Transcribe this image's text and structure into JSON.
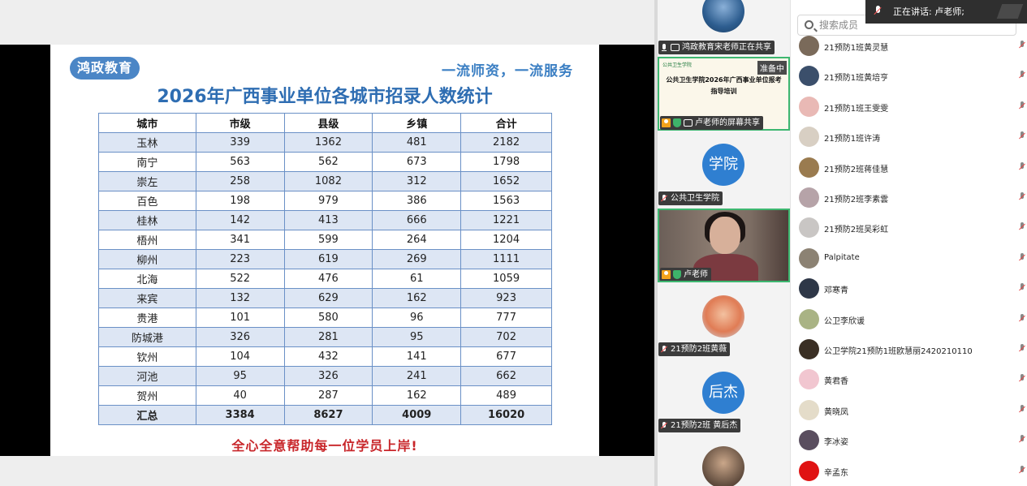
{
  "slide": {
    "logo": "鸿政教育",
    "slogan": "一流师资，一流服务",
    "title": "2026年广西事业单位各城市招录人数统计",
    "headers": [
      "城市",
      "市级",
      "县级",
      "乡镇",
      "合计"
    ],
    "rows": [
      [
        "玉林",
        "339",
        "1362",
        "481",
        "2182"
      ],
      [
        "南宁",
        "563",
        "562",
        "673",
        "1798"
      ],
      [
        "崇左",
        "258",
        "1082",
        "312",
        "1652"
      ],
      [
        "百色",
        "198",
        "979",
        "386",
        "1563"
      ],
      [
        "桂林",
        "142",
        "413",
        "666",
        "1221"
      ],
      [
        "梧州",
        "341",
        "599",
        "264",
        "1204"
      ],
      [
        "柳州",
        "223",
        "619",
        "269",
        "1111"
      ],
      [
        "北海",
        "522",
        "476",
        "61",
        "1059"
      ],
      [
        "来宾",
        "132",
        "629",
        "162",
        "923"
      ],
      [
        "贵港",
        "101",
        "580",
        "96",
        "777"
      ],
      [
        "防城港",
        "326",
        "281",
        "95",
        "702"
      ],
      [
        "钦州",
        "104",
        "432",
        "141",
        "677"
      ],
      [
        "河池",
        "95",
        "326",
        "241",
        "662"
      ],
      [
        "贺州",
        "40",
        "287",
        "162",
        "489"
      ]
    ],
    "total": [
      "汇总",
      "3384",
      "8627",
      "4009",
      "16020"
    ],
    "footer": "全心全意帮助每一位学员上岸!"
  },
  "video": {
    "sharing_label": "鸿政教育宋老师正在共享",
    "screen_badge": "准备中",
    "screen_logo": "公共卫生学院",
    "screen_title": "公共卫生学院2026年广西事业单位报考指导培训",
    "screen_share_label": "卢老师的屏幕共享",
    "college_avatar_text": "学院",
    "college_label": "公共卫生学院",
    "camera_label": "卢老师",
    "huangwei_label": "21预防2班黄薇",
    "houjie_avatar_text": "后杰",
    "houjie_label": "21预防2班  黄后杰",
    "colors": {
      "accent_green": "#3db770",
      "avatar_blue": "#2f7fd1"
    }
  },
  "members": {
    "search_placeholder": "搜索成员",
    "speaking": "正在讲话:  卢老师;",
    "items": [
      {
        "name": "21预防1班黄灵慧",
        "color": "#7a6a5a"
      },
      {
        "name": "21预防1班黄培亨",
        "color": "#3b4f6b"
      },
      {
        "name": "21预防1班王雯雯",
        "color": "#e9b9b5"
      },
      {
        "name": "21预防1班许涛",
        "color": "#d8cfc3"
      },
      {
        "name": "21预防2班蒋佳慧",
        "color": "#9a7b4f"
      },
      {
        "name": "21预防2班李素雲",
        "color": "#b6a3a8"
      },
      {
        "name": "21预防2班吴彩虹",
        "color": "#c9c6c4"
      },
      {
        "name": "Palpitate",
        "color": "#8c8273"
      },
      {
        "name": "邓寒青",
        "color": "#2e3747"
      },
      {
        "name": "公卫李欣谖",
        "color": "#a9b384"
      },
      {
        "name": "公卫学院21预防1班欧慧丽2420210110",
        "color": "#3a2f24"
      },
      {
        "name": "黄君香",
        "color": "#f1c6d0"
      },
      {
        "name": "黄晓凤",
        "color": "#e4dcc9"
      },
      {
        "name": "李冰姿",
        "color": "#5a4e5f"
      },
      {
        "name": "辛孟东",
        "color": "#e01212"
      }
    ]
  }
}
